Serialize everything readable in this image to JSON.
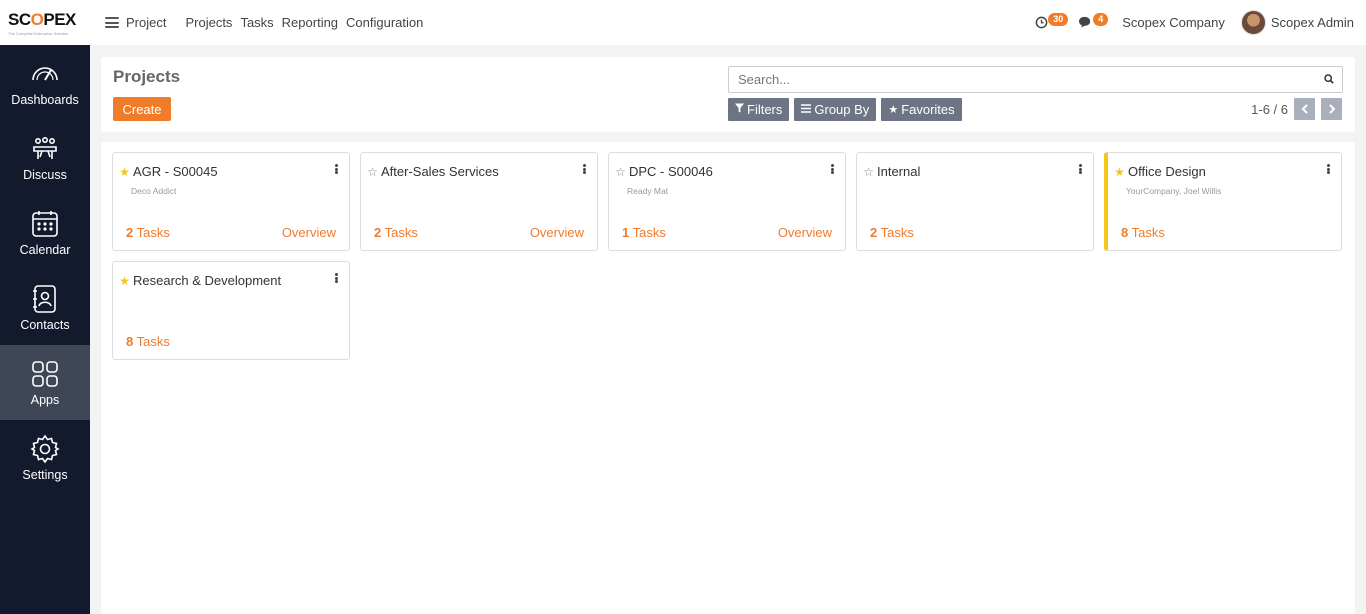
{
  "brand": {
    "logo_before": "SC",
    "logo_o": "O",
    "logo_after": "PEX",
    "logo_tagline": "The Complete Enterprise Solution"
  },
  "topbar": {
    "app_name": "Project",
    "menu": [
      "Projects",
      "Tasks",
      "Reporting",
      "Configuration"
    ],
    "activity_count": "30",
    "message_count": "4",
    "company": "Scopex Company",
    "user": "Scopex Admin"
  },
  "sidebar": {
    "items": [
      {
        "label": "Dashboards",
        "icon": "speedometer-icon"
      },
      {
        "label": "Discuss",
        "icon": "discuss-icon"
      },
      {
        "label": "Calendar",
        "icon": "calendar-icon"
      },
      {
        "label": "Contacts",
        "icon": "contacts-icon"
      },
      {
        "label": "Apps",
        "icon": "apps-grid-icon",
        "active": true
      },
      {
        "label": "Settings",
        "icon": "gear-icon"
      }
    ]
  },
  "control_panel": {
    "title": "Projects",
    "create_label": "Create",
    "search_placeholder": "Search...",
    "filters_label": "Filters",
    "group_by_label": "Group By",
    "favorites_label": "Favorites",
    "pager": "1-6 / 6"
  },
  "projects": [
    {
      "name": "AGR - S00045",
      "partner": "Deco Addict",
      "favorite": true,
      "task_count": "2",
      "tasks_word": "Tasks",
      "overview": "Overview"
    },
    {
      "name": "After-Sales Services",
      "partner": "",
      "favorite": false,
      "task_count": "2",
      "tasks_word": "Tasks",
      "overview": "Overview"
    },
    {
      "name": "DPC - S00046",
      "partner": "Ready Mat",
      "favorite": false,
      "task_count": "1",
      "tasks_word": "Tasks",
      "overview": "Overview"
    },
    {
      "name": "Internal",
      "partner": "",
      "favorite": false,
      "task_count": "2",
      "tasks_word": "Tasks",
      "overview": ""
    },
    {
      "name": "Office Design",
      "partner": "YourCompany, Joel Willis",
      "favorite": true,
      "task_count": "8",
      "tasks_word": "Tasks",
      "overview": "",
      "highlight_color": "#f5c518"
    },
    {
      "name": "Research & Development",
      "partner": "",
      "favorite": true,
      "task_count": "8",
      "tasks_word": "Tasks",
      "overview": ""
    }
  ],
  "colors": {
    "accent": "#f07c2a",
    "sidebar_bg": "#131a2e",
    "sidebar_active": "#3f4656",
    "favorite_star": "#f5c518"
  }
}
